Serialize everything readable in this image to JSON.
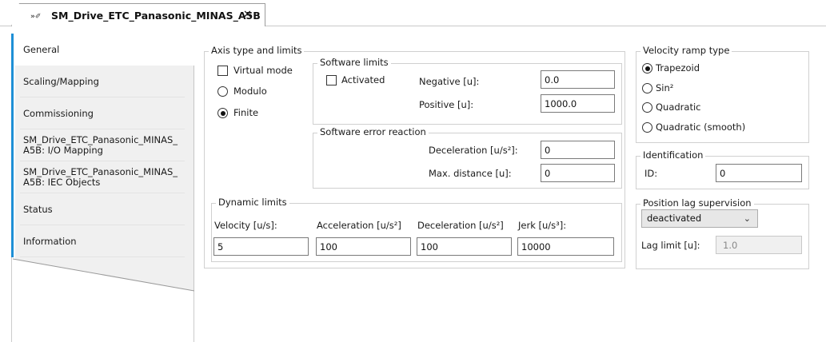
{
  "tab": {
    "icon": "»✐",
    "title": "SM_Drive_ETC_Panasonic_MINAS_A5B",
    "close": "✕"
  },
  "nav": {
    "items": [
      {
        "label": "General"
      },
      {
        "label": "Scaling/Mapping"
      },
      {
        "label": "Commissioning"
      },
      {
        "label": "SM_Drive_ETC_Panasonic_MINAS_\nA5B: I/O Mapping"
      },
      {
        "label": "SM_Drive_ETC_Panasonic_MINAS_\nA5B: IEC Objects"
      },
      {
        "label": "Status"
      },
      {
        "label": "Information"
      }
    ]
  },
  "axis": {
    "title": "Axis type and limits",
    "virtual_mode": "Virtual mode",
    "modulo": "Modulo",
    "finite": "Finite"
  },
  "software_limits": {
    "title": "Software limits",
    "activated": "Activated",
    "negative_label": "Negative [u]:",
    "negative_value": "0.0",
    "positive_label": "Positive [u]:",
    "positive_value": "1000.0"
  },
  "software_error": {
    "title": "Software error reaction",
    "decel_label": "Deceleration [u/s²]:",
    "decel_value": "0",
    "maxdist_label": "Max. distance [u]:",
    "maxdist_value": "0"
  },
  "dynamic": {
    "title": "Dynamic limits",
    "velocity_label": "Velocity [u/s]:",
    "velocity_value": "5",
    "accel_label": "Acceleration [u/s²]",
    "accel_value": "100",
    "decel_label": "Deceleration [u/s²]",
    "decel_value": "100",
    "jerk_label": "Jerk [u/s³]:",
    "jerk_value": "10000"
  },
  "ramp": {
    "title": "Velocity ramp type",
    "trapezoid": "Trapezoid",
    "sin2": "Sin²",
    "quadratic": "Quadratic",
    "quadratic_smooth": "Quadratic (smooth)"
  },
  "identification": {
    "title": "Identification",
    "id_label": "ID:",
    "id_value": "0"
  },
  "lag": {
    "title": "Position lag supervision",
    "selected": "deactivated",
    "limit_label": "Lag limit [u]:",
    "limit_value": "1.0"
  }
}
